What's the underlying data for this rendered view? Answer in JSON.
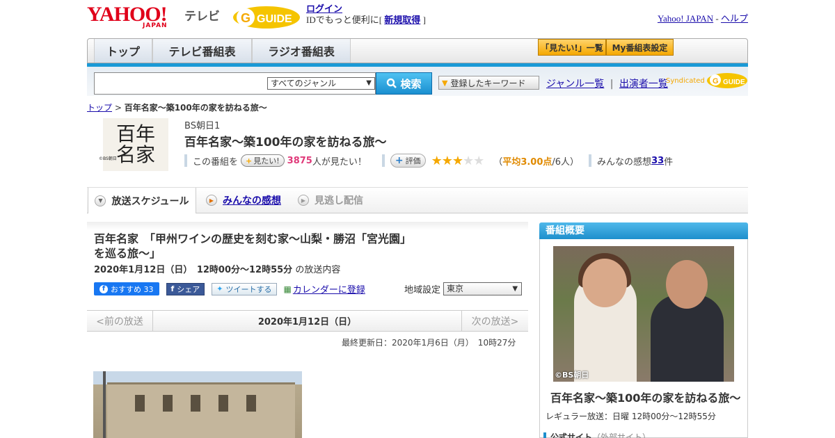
{
  "header": {
    "yahoo_logo": "YAHOO!",
    "yahoo_japan": "JAPAN",
    "tv_label": "テレビ",
    "gguide_logo": "G GUIDE",
    "login_link": "ログイン",
    "id_text_prefix": "IDでもっと便利に[ ",
    "signup_link": "新規取得",
    "id_text_suffix": " ]",
    "yahoo_japan_link": "Yahoo! JAPAN",
    "separator": " - ",
    "help_link": "ヘルプ"
  },
  "nav": {
    "tabs": [
      {
        "label": "トップ"
      },
      {
        "label": "テレビ番組表"
      },
      {
        "label": "ラジオ番組表"
      }
    ],
    "mitai_list": "「見たい!」一覧",
    "my_settings": "My番組表設定"
  },
  "search": {
    "input_value": "",
    "genre_selected": "すべてのジャンル",
    "search_button": "検索",
    "keyword_button": "登録したキーワード",
    "genre_link": "ジャンル一覧",
    "divider": "|",
    "cast_link": "出演者一覧",
    "syndicated": "Syndicated"
  },
  "breadcrumb": {
    "top": "トップ",
    "sep": " > ",
    "current": "百年名家～築100年の家を訪ねる旅～"
  },
  "program": {
    "image_text_1": "百年",
    "image_text_2": "名家",
    "image_credit": "©BS朝日",
    "channel": "BS朝日1",
    "title": "百年名家～築100年の家を訪ねる旅～",
    "mitai_prefix": "この番組を",
    "mitai_button": "見たい!",
    "mitai_count": "3875",
    "mitai_suffix": "人が見たい！",
    "eval_button": "評価",
    "rating": 3,
    "rating_max": 5,
    "avg_prefix": "（",
    "avg_text": "平均3.00点",
    "avg_suffix": "/6人）",
    "reviews_prefix": "みんなの感想 ",
    "reviews_count": "33",
    "reviews_suffix": "件"
  },
  "subtabs": [
    {
      "label": "放送スケジュール"
    },
    {
      "label": "みんなの感想"
    },
    {
      "label": "見逃し配信"
    }
  ],
  "episode": {
    "title": "百年名家　「甲州ワインの歴史を刻む家～山梨・勝沼「宮光園」を巡る旅～」",
    "date_bold": "2020年1月12日（日）　12時00分～12時55分",
    "date_suffix": "の放送内容",
    "fb_recommend": "おすすめ 33",
    "fb_share": "シェア",
    "tweet": "ツイートする",
    "calendar": "カレンダーに登録",
    "region_label": "地域設定",
    "region_value": "東京",
    "prev": "<前の放送",
    "current_date": "2020年1月12日（日）",
    "next": "次の放送>",
    "updated": "最終更新日：2020年1月6日（月）　10時27分"
  },
  "sidebar": {
    "heading": "番組概要",
    "photo_credit": "©BS朝日",
    "title": "百年名家～築100年の家を訪ねる旅～",
    "regular": "レギュラー放送：日曜 12時00分～12時55分",
    "official": "公式サイト",
    "official_note": "（外部サイト）"
  },
  "colors": {
    "accent_blue": "#1a9ad6",
    "yahoo_red": "#e0001a",
    "star": "#f5a800",
    "pink": "#e03a7a"
  }
}
